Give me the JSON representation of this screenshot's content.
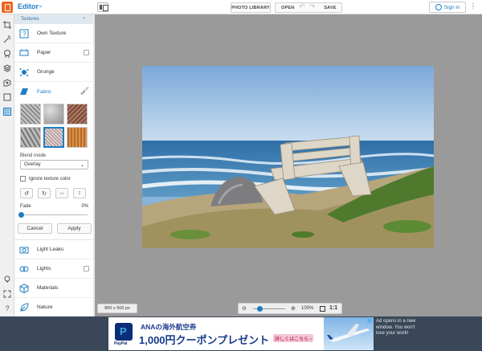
{
  "header": {
    "app_title": "Editor",
    "photo_library": "PHOTO LIBRARY",
    "open": "OPEN",
    "save": "SAVE",
    "sign_in": "Sign in"
  },
  "panel": {
    "section_title": "Textures",
    "items": [
      {
        "label": "Own Texture"
      },
      {
        "label": "Paper"
      },
      {
        "label": "Grunge"
      },
      {
        "label": "Fabric"
      }
    ],
    "blend_mode_label": "Blend mode",
    "blend_mode_value": "Overlay",
    "ignore_texture_color": "Ignore texture color",
    "fade_label": "Fade",
    "fade_value": "0%",
    "fade_level": 0,
    "cancel": "Cancel",
    "apply": "Apply",
    "more_items": [
      {
        "label": "Light Leaks"
      },
      {
        "label": "Lights"
      },
      {
        "label": "Materials"
      },
      {
        "label": "Nature"
      }
    ]
  },
  "canvas": {
    "image_size": "800 x 500 px",
    "zoom": "100%",
    "zoom_level": 0.2,
    "one_to_one": "1:1"
  },
  "ad": {
    "headline": "ANAの海外航空券",
    "offer": "1,000円クーポンプレゼント",
    "cta": "詳しくはこちら ›",
    "brand": "PayPal",
    "side_note": "Ad opens in a new window. You won't lose your work!"
  },
  "colors": {
    "accent": "#1d7ec2",
    "logo": "#f26522",
    "canvas_bg": "#9a9a9a",
    "bottom_band": "#3a4758"
  }
}
